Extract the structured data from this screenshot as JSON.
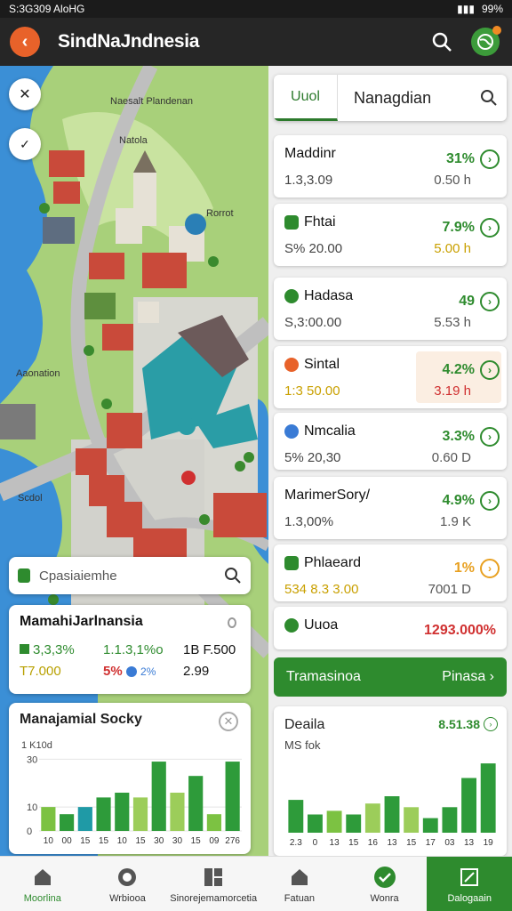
{
  "status": {
    "left": "S:3G309 AloHG",
    "right": "99%"
  },
  "header": {
    "title": "SindNaJndnesia"
  },
  "map": {
    "labels": [
      "Naesalt Plandenan",
      "Natola",
      "Rorrot",
      "Aaonation",
      "Scdol"
    ],
    "search_placeholder": "Cpasiaiemhe"
  },
  "summary_card": {
    "title": "MamahiJarlnansia",
    "r1c1": "3,3,3%",
    "r1c2": "1.1.3,1%o",
    "r1c3": "1B F.500",
    "r2c1": "T7.000",
    "r2c2": "5%",
    "r2c2b": "2%",
    "r2c3": "2.99"
  },
  "bar_card": {
    "title": "Manajamial Socky",
    "subtitle": "1 K10d"
  },
  "chart_data": [
    {
      "type": "bar",
      "title": "Manajamial Socky",
      "subtitle": "1 K10d",
      "yticks": [
        "0",
        "10",
        "30"
      ],
      "categories": [
        "10",
        "00",
        "15",
        "15",
        "10",
        "15",
        "30",
        "30",
        "15",
        "09",
        "276"
      ],
      "values": [
        10,
        7,
        10,
        14,
        16,
        14,
        29,
        16,
        23,
        7,
        29
      ],
      "colors": [
        "#7cc242",
        "#2e9b3a",
        "#1f9aa6",
        "#2e9b3a",
        "#2e9b3a",
        "#9ccd5a",
        "#2e9b3a",
        "#9ccd5a",
        "#2e9b3a",
        "#7cc242",
        "#2e9b3a"
      ],
      "ylim": [
        0,
        32
      ]
    },
    {
      "type": "bar",
      "title": "Deaila",
      "subtitle": "MS fok",
      "value_label": "8.51.38",
      "categories": [
        "2.3",
        "0",
        "13",
        "15",
        "16",
        "13",
        "15",
        "17",
        "03",
        "13",
        "19"
      ],
      "values": [
        9,
        5,
        6,
        5,
        8,
        10,
        7,
        4,
        7,
        15,
        19
      ],
      "colors": [
        "#2e9b3a",
        "#2e9b3a",
        "#7cc242",
        "#2e9b3a",
        "#9ccd5a",
        "#2e9b3a",
        "#9ccd5a",
        "#2e9b3a",
        "#2e9b3a",
        "#2e9b3a",
        "#2e9b3a"
      ],
      "ylim": [
        0,
        20
      ]
    }
  ],
  "panel": {
    "tab_active": "Uuol",
    "tab_label": "Nanagdian",
    "items": [
      {
        "name": "Maddinr",
        "sub": "1.3,3.09",
        "pct": "31%",
        "val": "0.50 h",
        "pct_color": "#2e8b2e",
        "icon_color": ""
      },
      {
        "name": "Fhtai",
        "sub": "S% 20.00",
        "pct": "7.9%",
        "val": "5.00 h",
        "pct_color": "#2e8b2e",
        "icon_color": "#2e8b2e"
      },
      {
        "name": "Hadasa",
        "sub": "S,3:00.00",
        "pct": "49",
        "val": "5.53 h",
        "pct_color": "#2e8b2e",
        "icon_color": "#2e8b2e"
      },
      {
        "name": "Sintal",
        "sub": "1:3 50.00",
        "pct": "4.2%",
        "val": "3.19 h",
        "pct_color": "#2e8b2e",
        "icon_color": "#e8622a"
      },
      {
        "name": "Nmcalia",
        "sub": "5% 20,30",
        "pct": "3.3%",
        "val": "0.60 D",
        "pct_color": "#2e8b2e",
        "icon_color": "#3a7bd5"
      },
      {
        "name": "MarimerSory/",
        "sub": "1.3,00%",
        "pct": "4.9%",
        "val": "1.9 K",
        "pct_color": "#2e8b2e",
        "icon_color": ""
      },
      {
        "name": "Phlaeard",
        "sub": "534 8.3 3.00",
        "pct": "1%",
        "val": "7001 D",
        "pct_color": "#e8a020",
        "icon_color": "#2e8b2e"
      },
      {
        "name": "Uuoa",
        "sub": "",
        "pct": "1293.000%",
        "val": "",
        "pct_color": "#d03030",
        "icon_color": "#2e8b2e"
      }
    ],
    "green_button": {
      "left": "Tramasinoa",
      "right": "Pinasa"
    }
  },
  "navbar": {
    "items": [
      "Moorlina",
      "Wrbiooa",
      "Sinorejemamorcetia",
      "Fatuan",
      "Wonra",
      "Dalogaain"
    ]
  }
}
